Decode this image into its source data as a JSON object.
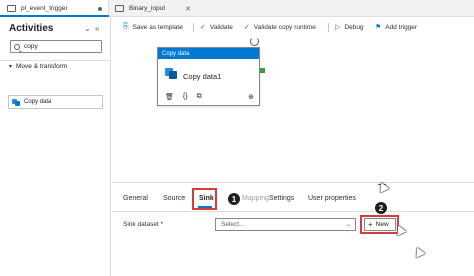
{
  "tabs": [
    {
      "label": "pl_event_trigger"
    },
    {
      "label": "Binary_input"
    }
  ],
  "activities": {
    "title": "Activities",
    "collapse_label": "⌄",
    "hide_label": "«",
    "search": {
      "value": "copy"
    },
    "group": {
      "label": "Move & transform"
    },
    "item": {
      "label": "Copy data"
    }
  },
  "toolbar": {
    "save_template": "Save as template",
    "validate": "Validate",
    "validate_runtime": "Validate copy runtime",
    "debug": "Debug",
    "add_trigger": "Add trigger"
  },
  "node": {
    "type": "Copy data",
    "name": "Copy data1"
  },
  "properties": {
    "tabs": [
      "General",
      "Source",
      "Sink",
      "Mapping",
      "Settings",
      "User properties"
    ],
    "active_tab": "Sink",
    "step1": "1",
    "step2": "2",
    "sink_dataset_label": "Sink dataset",
    "required_marker": "*",
    "sink_dataset_value": "Select...",
    "new_button": "New"
  },
  "colors": {
    "accent": "#0078d4",
    "highlight": "#d83b3b",
    "success": "#2fa33c"
  }
}
